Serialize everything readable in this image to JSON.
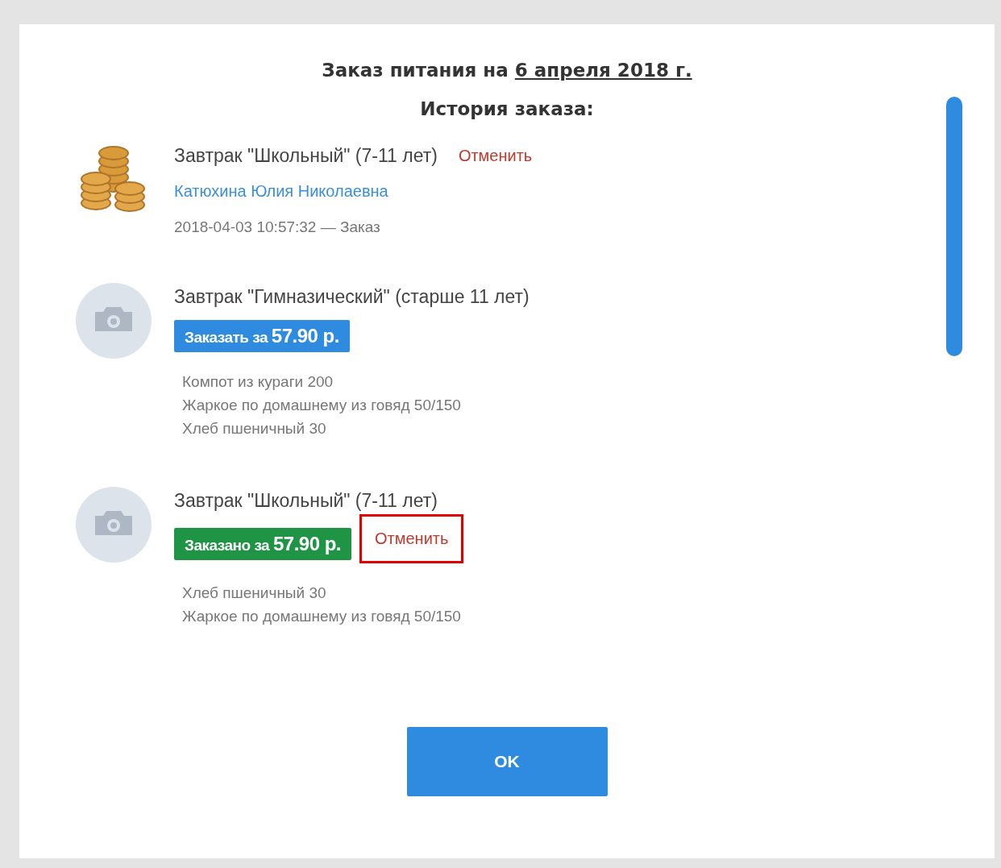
{
  "title": {
    "prefix": "Заказ питания на",
    "date": "6 апреля 2018 г."
  },
  "subtitle": "История заказа:",
  "items": [
    {
      "kind": "history",
      "name": "Завтрак \"Школьный\" (7-11 лет)",
      "cancel": {
        "label": "Отменить",
        "highlighted": false
      },
      "person": "Катюхина Юлия Николаевна",
      "timestamp": "2018-04-03 10:57:32 — Заказ"
    },
    {
      "kind": "offer",
      "name": "Завтрак \"Гимназический\" (старше 11 лет)",
      "action": "Заказать за **57.90 р.**",
      "dishes": [
        "Компот из кураги 200",
        "Жаркое по домашнему из говяд 50/150",
        "Хлеб пшеничный 30"
      ]
    },
    {
      "kind": "ordered",
      "name": "Завтрак \"Школьный\" (7-11 лет)",
      "action": "Заказано за **57.90 р.**",
      "cancel": {
        "label": "Отменить",
        "highlighted": true
      },
      "dishes": [
        "Хлеб пшеничный 30",
        "Жаркое по домашнему из говяд 50/150"
      ]
    }
  ],
  "ok_button": "OK"
}
